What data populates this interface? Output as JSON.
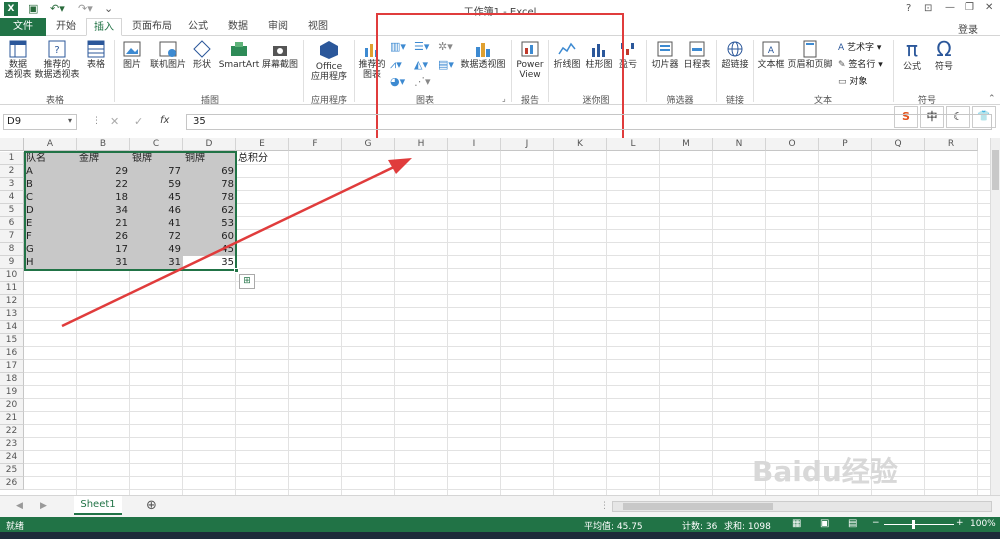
{
  "window": {
    "title": "工作簿1 - Excel",
    "help": "?",
    "minimize": "—",
    "restore": "❐",
    "close": "✕",
    "login": "登录"
  },
  "tabs": [
    "文件",
    "开始",
    "插入",
    "页面布局",
    "公式",
    "数据",
    "审阅",
    "视图"
  ],
  "ribbon": {
    "pivot": "数据\n透视表",
    "rec_pivot": "推荐的\n数据透视表",
    "table": "表格",
    "grp_tables": "表格",
    "pictures": "图片",
    "online_pictures": "联机图片",
    "shapes": "形状",
    "smartart": "SmartArt",
    "screenshot": "屏幕截图",
    "grp_illus": "插图",
    "office_apps": "Office\n应用程序",
    "grp_apps": "应用程序",
    "rec_charts": "推荐的\n图表",
    "pivot_chart": "数据透视图",
    "grp_charts": "图表",
    "power_view": "Power\nView",
    "grp_reports": "报告",
    "line": "折线图",
    "column": "柱形图",
    "winloss": "盈亏",
    "grp_spark": "迷你图",
    "slicer": "切片器",
    "timeline": "日程表",
    "grp_filter": "筛选器",
    "hyperlink": "超链接",
    "grp_links": "链接",
    "textbox": "文本框",
    "header_footer": "页眉和页脚",
    "wordart": "艺术字",
    "signature": "签名行",
    "object": "对象",
    "grp_text": "文本",
    "equation": "公式",
    "symbol": "符号",
    "grp_symbols": "符号",
    "ime": [
      "S",
      "中",
      "☾",
      "👕"
    ]
  },
  "formula_bar": {
    "name_box": "D9",
    "fx": "fx",
    "value": "35"
  },
  "columns": [
    "A",
    "B",
    "C",
    "D",
    "E",
    "F",
    "G",
    "H",
    "I",
    "J",
    "K",
    "L",
    "M",
    "N",
    "O",
    "P",
    "Q",
    "R"
  ],
  "rows": [
    "1",
    "2",
    "3",
    "4",
    "5",
    "6",
    "7",
    "8",
    "9",
    "10",
    "11",
    "12",
    "13",
    "14",
    "15",
    "16",
    "17",
    "18",
    "19",
    "20",
    "21",
    "22",
    "23",
    "24",
    "25",
    "26"
  ],
  "headers": [
    "队名",
    "金牌",
    "银牌",
    "铜牌",
    "总积分"
  ],
  "table": [
    [
      "A",
      "29",
      "77",
      "69"
    ],
    [
      "B",
      "22",
      "59",
      "78"
    ],
    [
      "C",
      "18",
      "45",
      "78"
    ],
    [
      "D",
      "34",
      "46",
      "62"
    ],
    [
      "E",
      "21",
      "41",
      "53"
    ],
    [
      "F",
      "26",
      "72",
      "60"
    ],
    [
      "G",
      "17",
      "49",
      "45"
    ],
    [
      "H",
      "31",
      "31",
      "35"
    ]
  ],
  "sheet": {
    "name": "Sheet1",
    "add": "⊕"
  },
  "status": {
    "ready": "就绪",
    "average": "平均值: 45.75",
    "count": "计数: 36",
    "sum": "求和: 1098",
    "zoom": "100%"
  },
  "watermark": "Baidu经验"
}
